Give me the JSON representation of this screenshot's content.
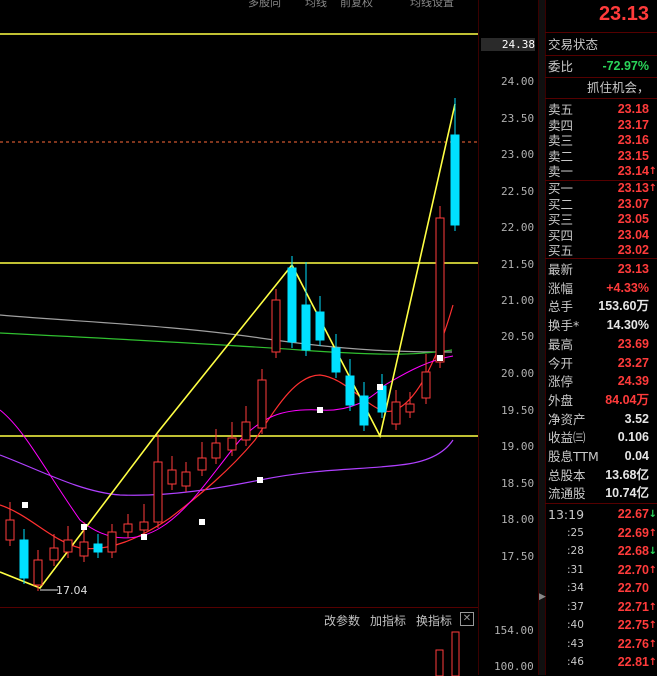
{
  "top_tabs": [
    "多股同",
    "均线",
    "前复权",
    "均线设置"
  ],
  "price_axis": {
    "labels": [
      "24.38",
      "24.00",
      "23.50",
      "23.00",
      "22.50",
      "22.00",
      "21.50",
      "21.00",
      "20.50",
      "20.00",
      "19.50",
      "19.00",
      "18.50",
      "18.00",
      "17.50"
    ],
    "highlight": "24.38"
  },
  "volume_axis": {
    "labels": [
      "154.00",
      "100.00"
    ]
  },
  "chart_annotations": {
    "low_label": "17.04"
  },
  "toolbar": {
    "params": "改参数",
    "add_indicator": "加指标",
    "switch_indicator": "换指标",
    "close": "✕"
  },
  "quote": {
    "price": "23.13",
    "status_title": "交易状态",
    "weibi_label": "委比",
    "weibi_value": "-72.97%",
    "news_ticker": "抓住机会，",
    "sell": [
      {
        "label": "卖五",
        "price": "23.18"
      },
      {
        "label": "卖四",
        "price": "23.17"
      },
      {
        "label": "卖三",
        "price": "23.16"
      },
      {
        "label": "卖二",
        "price": "23.15"
      },
      {
        "label": "卖一",
        "price": "23.14"
      }
    ],
    "buy": [
      {
        "label": "买一",
        "price": "23.13"
      },
      {
        "label": "买二",
        "price": "23.07"
      },
      {
        "label": "买三",
        "price": "23.05"
      },
      {
        "label": "买四",
        "price": "23.04"
      },
      {
        "label": "买五",
        "price": "23.02"
      }
    ],
    "stats": [
      {
        "label": "最新",
        "value": "23.13",
        "color": "red"
      },
      {
        "label": "涨幅",
        "value": "+4.33%",
        "color": "red"
      },
      {
        "label": "总手",
        "value": "153.60万",
        "color": "white"
      },
      {
        "label": "换手*",
        "value": "14.30%",
        "color": "white"
      },
      {
        "label": "最高",
        "value": "23.69",
        "color": "red"
      },
      {
        "label": "今开",
        "value": "23.27",
        "color": "red"
      },
      {
        "label": "涨停",
        "value": "24.39",
        "color": "red"
      },
      {
        "label": "外盘",
        "value": "84.04万",
        "color": "red"
      },
      {
        "label": "净资产",
        "value": "3.52",
        "color": "white"
      },
      {
        "label": "收益㈢",
        "value": "0.106",
        "color": "white"
      },
      {
        "label": "股息TTM",
        "value": "0.04",
        "color": "white"
      },
      {
        "label": "总股本",
        "value": "13.68亿",
        "color": "white"
      },
      {
        "label": "流通股",
        "value": "10.74亿",
        "color": "white"
      }
    ],
    "ticks": [
      {
        "time": "13:19",
        "price": "22.67",
        "dir": "down"
      },
      {
        "time": ":25",
        "price": "22.69",
        "dir": "up"
      },
      {
        "time": ":28",
        "price": "22.68",
        "dir": "down"
      },
      {
        "time": ":31",
        "price": "22.70",
        "dir": "up"
      },
      {
        "time": ":34",
        "price": "22.70",
        "dir": ""
      },
      {
        "time": ":37",
        "price": "22.71",
        "dir": "up"
      },
      {
        "time": ":40",
        "price": "22.75",
        "dir": "up"
      },
      {
        "time": ":43",
        "price": "22.76",
        "dir": "up"
      },
      {
        "time": ":46",
        "price": "22.81",
        "dir": "up"
      }
    ]
  },
  "colors": {
    "up": "#ff3b3b",
    "down": "#00e0ff",
    "trend": "#ffff44",
    "ma_red": "#ff3030",
    "ma_purple": "#b040ff",
    "ma_green": "#30c030",
    "ma_gray": "#a0a0a0"
  }
}
